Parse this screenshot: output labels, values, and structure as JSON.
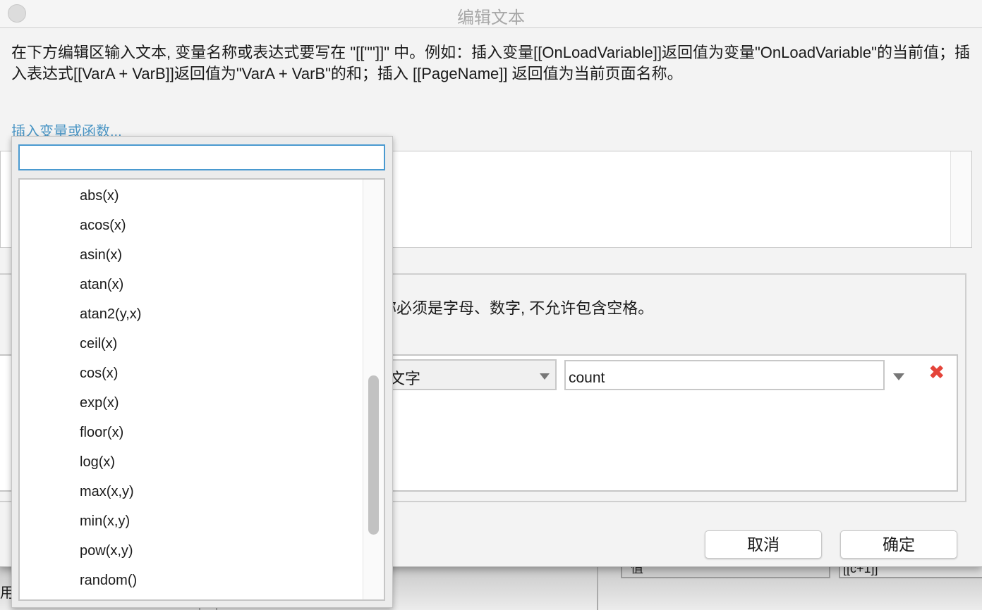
{
  "dialog": {
    "title": "编辑文本",
    "description": "在下方编辑区输入文本, 变量名称或表达式要写在 \"[[\"\"]]\" 中。例如：插入变量[[OnLoadVariable]]返回值为变量\"OnLoadVariable\"的当前值；插入表达式[[VarA + VarB]]返回值为\"VarA + VarB\"的和；插入 [[PageName]] 返回值为当前页面名称。",
    "insert_link": "插入变量或函数...",
    "editor_value": "",
    "local_vars_hint": "称必须是字母、数字, 不允许包含空格。",
    "row": {
      "type_select": "文字",
      "value": "count"
    },
    "cancel_label": "取消",
    "ok_label": "确定"
  },
  "popup": {
    "search_value": "",
    "items": [
      "abs(x)",
      "acos(x)",
      "asin(x)",
      "atan(x)",
      "atan2(y,x)",
      "ceil(x)",
      "cos(x)",
      "exp(x)",
      "floor(x)",
      "log(x)",
      "max(x,y)",
      "min(x,y)",
      "pow(x,y)",
      "random()"
    ],
    "scroll_position": 0.55
  },
  "background": {
    "left_text": "用",
    "cell1": "值",
    "cell2": "[[c+1]]"
  },
  "colors": {
    "link": "#4a95c4",
    "focus": "#4a9ad0",
    "delete": "#e4443a"
  }
}
